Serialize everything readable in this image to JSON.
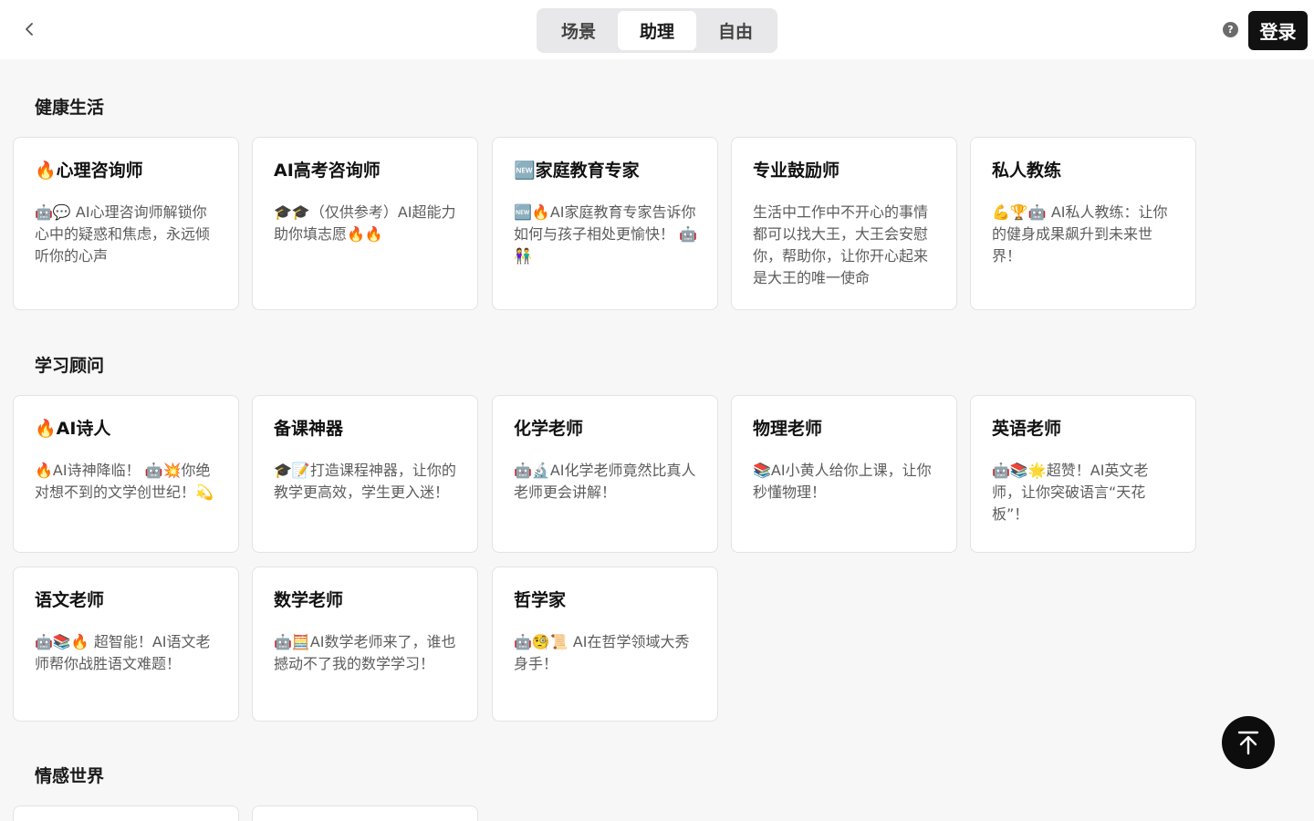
{
  "header": {
    "tabs": [
      "场景",
      "助理",
      "自由"
    ],
    "active_tab": "助理",
    "help_icon_glyph": "?",
    "login_label": "登录"
  },
  "sections": [
    {
      "title": "健康生活",
      "cards": [
        {
          "title": "🔥心理咨询师",
          "desc": "🤖💬 AI心理咨询师解锁你心中的疑惑和焦虑，永远倾听你的心声"
        },
        {
          "title": "AI高考咨询师",
          "desc": "🎓🎓（仅供参考）AI超能力助你填志愿🔥🔥"
        },
        {
          "title": "🆕家庭教育专家",
          "desc": "🆕🔥AI家庭教育专家告诉你如何与孩子相处更愉快！ 🤖👫"
        },
        {
          "title": "专业鼓励师",
          "desc": "生活中工作中不开心的事情都可以找大王，大王会安慰你，帮助你，让你开心起来是大王的唯一使命"
        },
        {
          "title": "私人教练",
          "desc": "💪🏆🤖 AI私人教练：让你的健身成果飙升到未来世界！"
        }
      ]
    },
    {
      "title": "学习顾问",
      "cards": [
        {
          "title": "🔥AI诗人",
          "desc": "🔥AI诗神降临！ 🤖💥你绝对想不到的文学创世纪！💫"
        },
        {
          "title": "备课神器",
          "desc": "🎓📝打造课程神器，让你的教学更高效，学生更入迷！"
        },
        {
          "title": "化学老师",
          "desc": "🤖🔬AI化学老师竟然比真人老师更会讲解！"
        },
        {
          "title": "物理老师",
          "desc": "📚AI小黄人给你上课，让你秒懂物理！"
        },
        {
          "title": "英语老师",
          "desc": "🤖📚🌟超赞！AI英文老师，让你突破语言“天花板”！"
        },
        {
          "title": "语文老师",
          "desc": "🤖📚🔥 超智能！AI语文老师帮你战胜语文难题！"
        },
        {
          "title": "数学老师",
          "desc": "🤖🧮AI数学老师来了，谁也撼动不了我的数学学习！"
        },
        {
          "title": "哲学家",
          "desc": "🤖🧐📜 AI在哲学领域大秀身手！"
        }
      ]
    },
    {
      "title": "情感世界",
      "cards": [
        {
          "title": "",
          "desc": ""
        },
        {
          "title": "",
          "desc": ""
        }
      ]
    }
  ],
  "colors": {
    "accent_dark": "#111111",
    "page_bg": "#f7f7f8",
    "card_border": "#e3e3e6"
  },
  "icons": [
    "chevron-left-icon",
    "help-icon",
    "arrow-up-to-top-icon"
  ]
}
